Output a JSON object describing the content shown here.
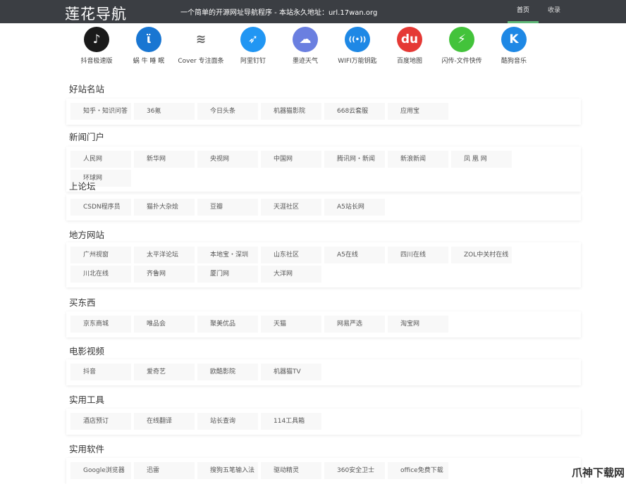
{
  "header": {
    "logo": "莲花导航",
    "slogan": "一个简单的开源网址导航程序 - 本站永久地址：url.17wan.org",
    "nav": [
      {
        "label": "首页",
        "active": true
      },
      {
        "label": "收录",
        "active": false
      }
    ]
  },
  "apps": [
    {
      "label": "抖音极速版",
      "icon": "tiktok-icon",
      "color": "#1a1a1a",
      "glyph": "♪"
    },
    {
      "label": "蜗 牛 睡 眠",
      "icon": "snail-sleep-icon",
      "color": "#1976d2",
      "glyph": "ϊ"
    },
    {
      "label": "Cover 专注面条",
      "icon": "noodle-icon",
      "color": "#ffffff",
      "glyph": "≋"
    },
    {
      "label": "阿里钉钉",
      "icon": "dingtalk-icon",
      "color": "#2196f3",
      "glyph": "➶"
    },
    {
      "label": "墨迹天气",
      "icon": "weather-icon",
      "color": "#6a7fe0",
      "glyph": "☁"
    },
    {
      "label": "WIFI万能钥匙",
      "icon": "wifi-key-icon",
      "color": "#1e88e5",
      "glyph": "((•))"
    },
    {
      "label": "百度地图",
      "icon": "baidu-map-icon",
      "color": "#e53935",
      "glyph": "du"
    },
    {
      "label": "闪传-文件快传",
      "icon": "flash-transfer-icon",
      "color": "#43c33b",
      "glyph": "⚡"
    },
    {
      "label": "酷狗音乐",
      "icon": "kugou-icon",
      "color": "#1e88e5",
      "glyph": "K"
    }
  ],
  "sections": [
    {
      "title": "好站名站",
      "items": [
        "知乎・知识问答",
        "36氪",
        "今日头条",
        "机器猫影院",
        "668云套服",
        "应用宝"
      ]
    },
    {
      "title": "新闻门户",
      "items": [
        "人民网",
        "新华网",
        "央视网",
        "中国网",
        "腾讯网・新闻",
        "新浪新闻",
        "凤 凰 网",
        "环球网"
      ]
    },
    {
      "title": "上论坛",
      "items": [
        "CSDN程序员",
        "猫扑大杂烩",
        "豆瓣",
        "天涯社区",
        "A5站长网"
      ]
    },
    {
      "title": "地方网站",
      "items": [
        "广州视窗",
        "太平洋论坛",
        "本地宝・深圳",
        "山东社区",
        "A5在线",
        "四川在线",
        "ZOL中关村在线",
        "川北在线",
        "齐鲁网",
        "厦门网",
        "大洋网"
      ]
    },
    {
      "title": "买东西",
      "items": [
        "京东商城",
        "唯品会",
        "聚美优品",
        "天猫",
        "网易严选",
        "淘宝网"
      ]
    },
    {
      "title": "电影视频",
      "items": [
        "抖音",
        "爱奇艺",
        "欧酷影院",
        "机器猫TV"
      ]
    },
    {
      "title": "实用工具",
      "items": [
        "酒店预订",
        "在线翻译",
        "站长查询",
        "114工具箱"
      ]
    },
    {
      "title": "实用软件",
      "items": [
        "Google浏览器",
        "迅雷",
        "搜狗五笔输入法",
        "驱动精灵",
        "360安全卫士",
        "office免费下载"
      ]
    }
  ],
  "watermark": "爪神下载网"
}
